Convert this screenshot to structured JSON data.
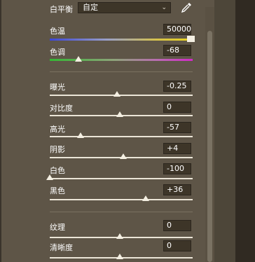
{
  "white_balance": {
    "label": "白平衡",
    "selected": "自定",
    "eyedropper_icon": "eyedropper-icon"
  },
  "sliders": {
    "temperature": {
      "label": "色温",
      "value": "50000",
      "level": 1.0
    },
    "tint": {
      "label": "色调",
      "value": "-68",
      "level": 0.2
    },
    "exposure": {
      "label": "曝光",
      "value": "-0.25",
      "level": 0.47
    },
    "contrast": {
      "label": "对比度",
      "value": "0",
      "level": 0.5
    },
    "highlights": {
      "label": "高光",
      "value": "-57",
      "level": 0.21
    },
    "shadows": {
      "label": "阴影",
      "value": "+4",
      "level": 0.52
    },
    "whites": {
      "label": "白色",
      "value": "-100",
      "level": 0.0
    },
    "blacks": {
      "label": "黑色",
      "value": "+36",
      "level": 0.67
    },
    "texture": {
      "label": "纹理",
      "value": "0",
      "level": 0.5
    },
    "clarity": {
      "label": "清晰度",
      "value": "0",
      "level": 0.5
    }
  }
}
